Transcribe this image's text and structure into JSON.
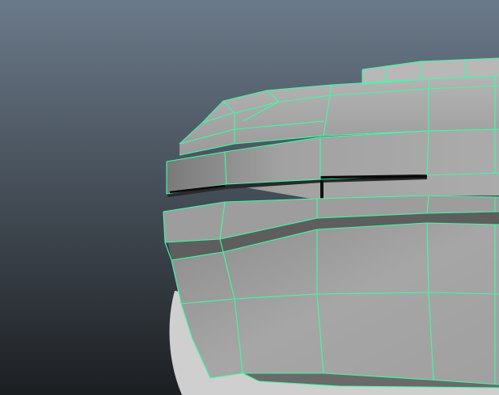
{
  "viewport": {
    "background_top": "#6b7a8a",
    "background_bottom": "#1c1f22",
    "mesh_fill_light": "#a8a8a8",
    "mesh_fill_mid": "#8e8e8e",
    "mesh_fill_dark": "#5a5a5a",
    "wireframe_color": "#3dfba7",
    "selection_highlight": "wireframe"
  }
}
